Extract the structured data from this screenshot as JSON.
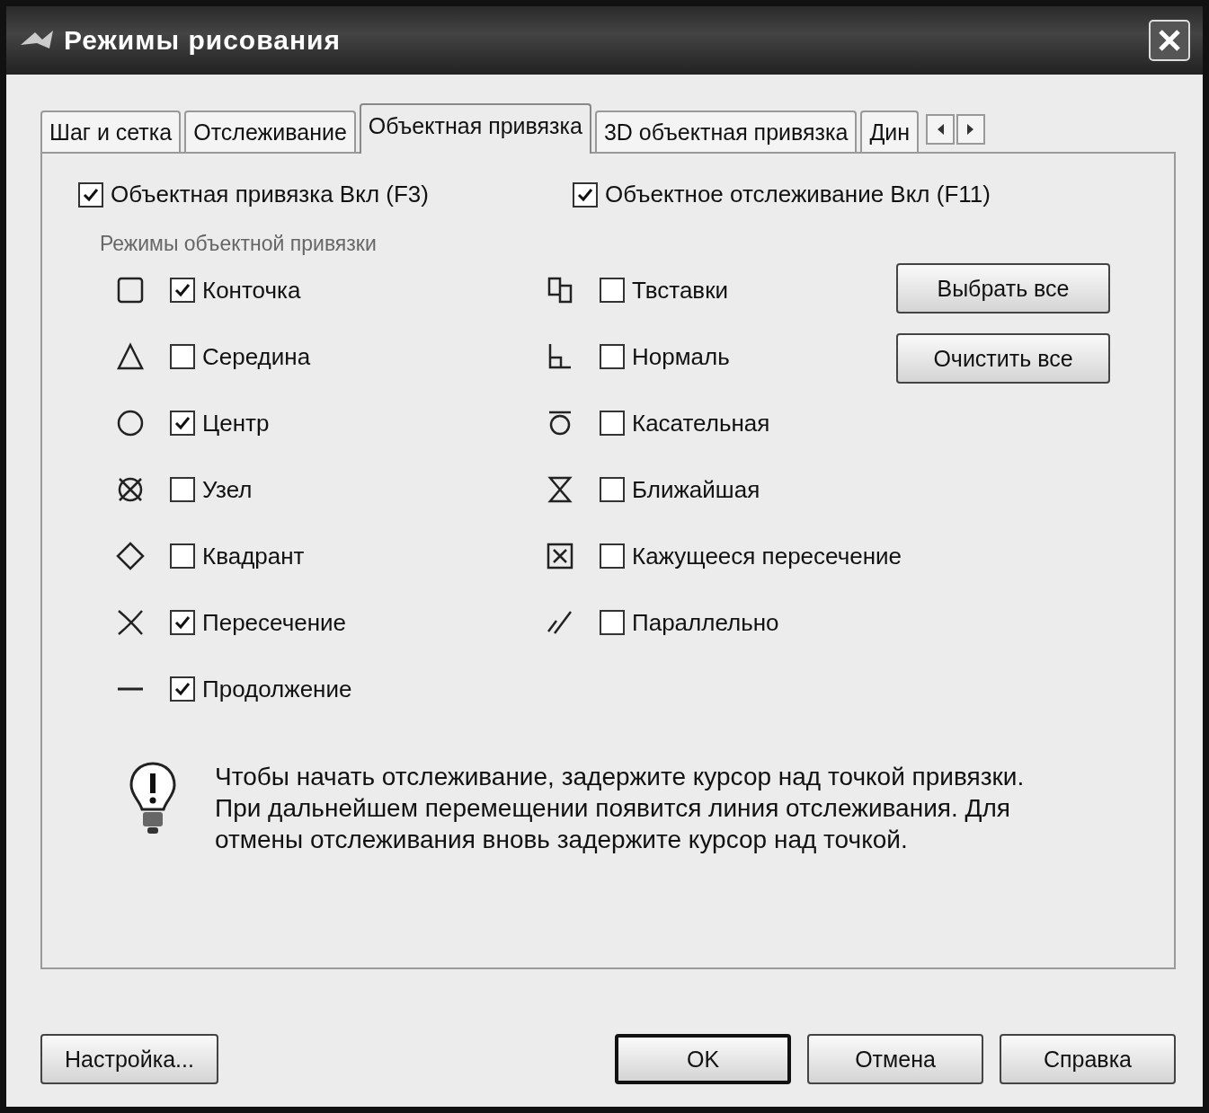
{
  "window": {
    "title": "Режимы рисования"
  },
  "tabs": [
    {
      "label": "Шаг и сетка",
      "selected": false
    },
    {
      "label": "Отслеживание",
      "selected": false
    },
    {
      "label": "Объектная привязка",
      "selected": true
    },
    {
      "label": "3D объектная привязка",
      "selected": false
    },
    {
      "label": "Дин",
      "selected": false
    }
  ],
  "toggles": [
    {
      "label": "Объектная привязка Вкл (F3)",
      "checked": true
    },
    {
      "label": "Объектное отслеживание Вкл (F11)",
      "checked": true
    }
  ],
  "snap_modes": {
    "title": "Режимы объектной привязки",
    "left": [
      {
        "label": "Конточка",
        "checked": true
      },
      {
        "label": "Середина",
        "checked": false
      },
      {
        "label": "Центр",
        "checked": true
      },
      {
        "label": "Узел",
        "checked": false
      },
      {
        "label": "Квадрант",
        "checked": false
      },
      {
        "label": "Пересечение",
        "checked": true
      },
      {
        "label": "Продолжение",
        "checked": true
      }
    ],
    "right": [
      {
        "label": "Твставки",
        "checked": false
      },
      {
        "label": "Нормаль",
        "checked": false
      },
      {
        "label": "Касательная",
        "checked": false
      },
      {
        "label": "Ближайшая",
        "checked": false
      },
      {
        "label": "Кажущееся пересечение",
        "checked": false
      },
      {
        "label": "Параллельно",
        "checked": false
      }
    ],
    "actions": [
      "Выбрать все",
      "Очистить все"
    ]
  },
  "hint": "Чтобы начать отслеживание, задержите курсор над точкой привязки. При дальнейшем перемещении появится линия отслеживания. Для отмены отслеживания вновь задержите курсор над точкой.",
  "footer": {
    "options_button": "Настройка...",
    "buttons": [
      {
        "label": "OK",
        "default": true
      },
      {
        "label": "Отмена",
        "default": false
      },
      {
        "label": "Справка",
        "default": false
      }
    ]
  }
}
